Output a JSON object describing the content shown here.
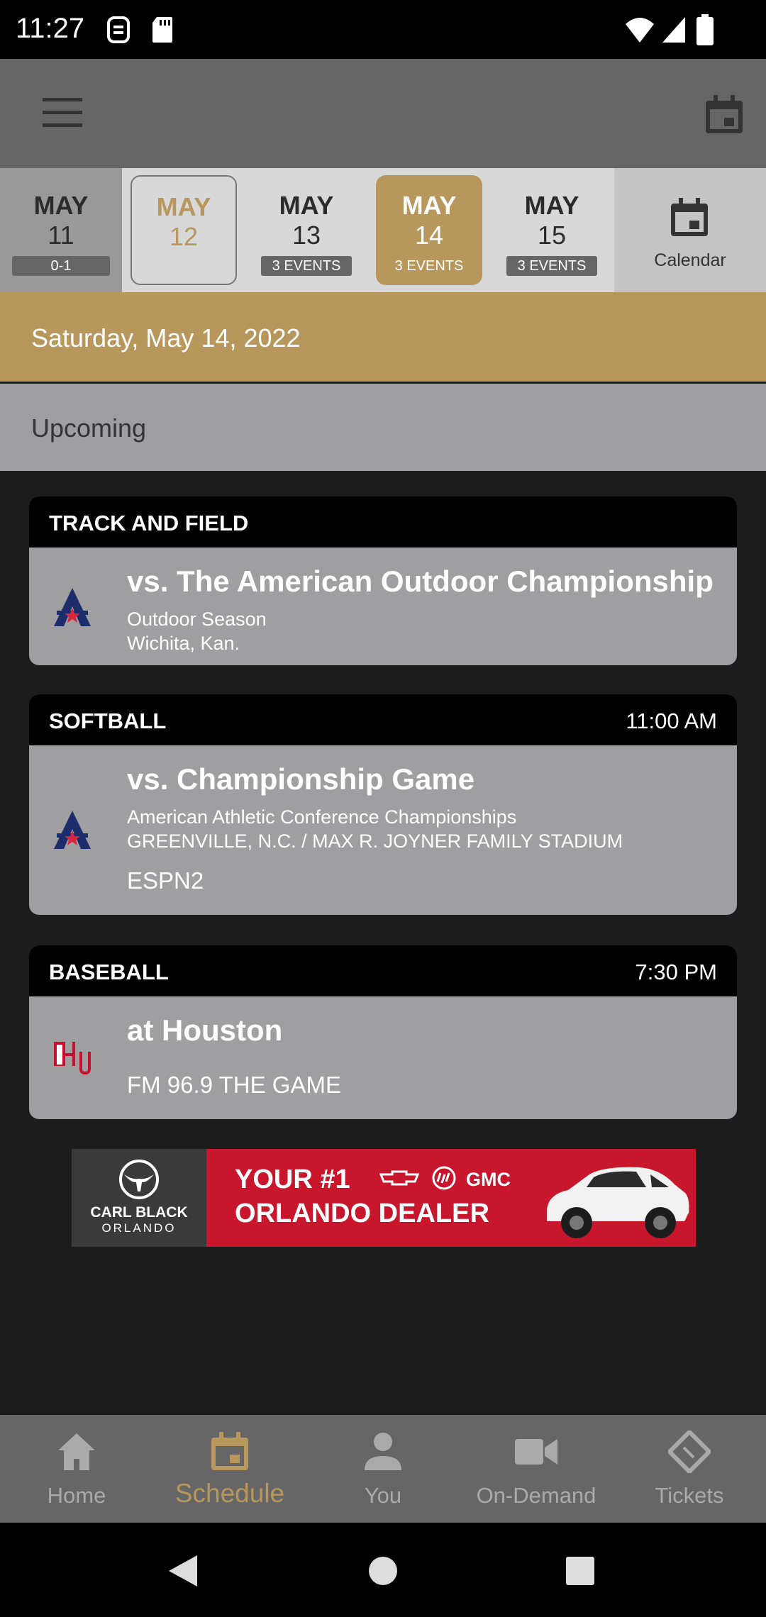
{
  "status_bar": {
    "time": "11:27"
  },
  "date_strip": {
    "days": [
      {
        "month": "MAY",
        "day": "11",
        "badge": "0-1"
      },
      {
        "month": "MAY",
        "day": "12",
        "badge": ""
      },
      {
        "month": "MAY",
        "day": "13",
        "badge": "3 EVENTS"
      },
      {
        "month": "MAY",
        "day": "14",
        "badge": "3 EVENTS"
      },
      {
        "month": "MAY",
        "day": "15",
        "badge": "3 EVENTS"
      }
    ],
    "calendar_label": "Calendar",
    "selected_color": "#b8975c"
  },
  "date_heading": "Saturday, May 14, 2022",
  "section_label": "Upcoming",
  "events": [
    {
      "sport": "TRACK AND FIELD",
      "time": "",
      "title": "vs. The American Outdoor Championship",
      "line1": "Outdoor Season",
      "line2": "Wichita, Kan.",
      "broadcast": ""
    },
    {
      "sport": "SOFTBALL",
      "time": "11:00 AM",
      "title": "vs. Championship Game",
      "line1": "American Athletic Conference Championships",
      "line2": "GREENVILLE, N.C. / MAX R. JOYNER FAMILY STADIUM",
      "broadcast": "ESPN2"
    },
    {
      "sport": "BASEBALL",
      "time": "7:30 PM",
      "title": "at Houston",
      "line1": "",
      "line2": "",
      "broadcast": "FM 96.9 THE GAME"
    }
  ],
  "ad": {
    "brand_line1": "CARL BLACK",
    "brand_line2": "ORLANDO",
    "headline1": "YOUR #1",
    "headline_brand": "GMC",
    "headline2": "ORLANDO DEALER"
  },
  "bottom_nav": [
    {
      "label": "Home",
      "icon": "home-icon"
    },
    {
      "label": "Schedule",
      "icon": "calendar-icon"
    },
    {
      "label": "You",
      "icon": "person-icon"
    },
    {
      "label": "On-Demand",
      "icon": "video-icon"
    },
    {
      "label": "Tickets",
      "icon": "ticket-icon"
    }
  ],
  "colors": {
    "accent": "#b8975c",
    "nav_inactive": "#aaaaaa"
  }
}
